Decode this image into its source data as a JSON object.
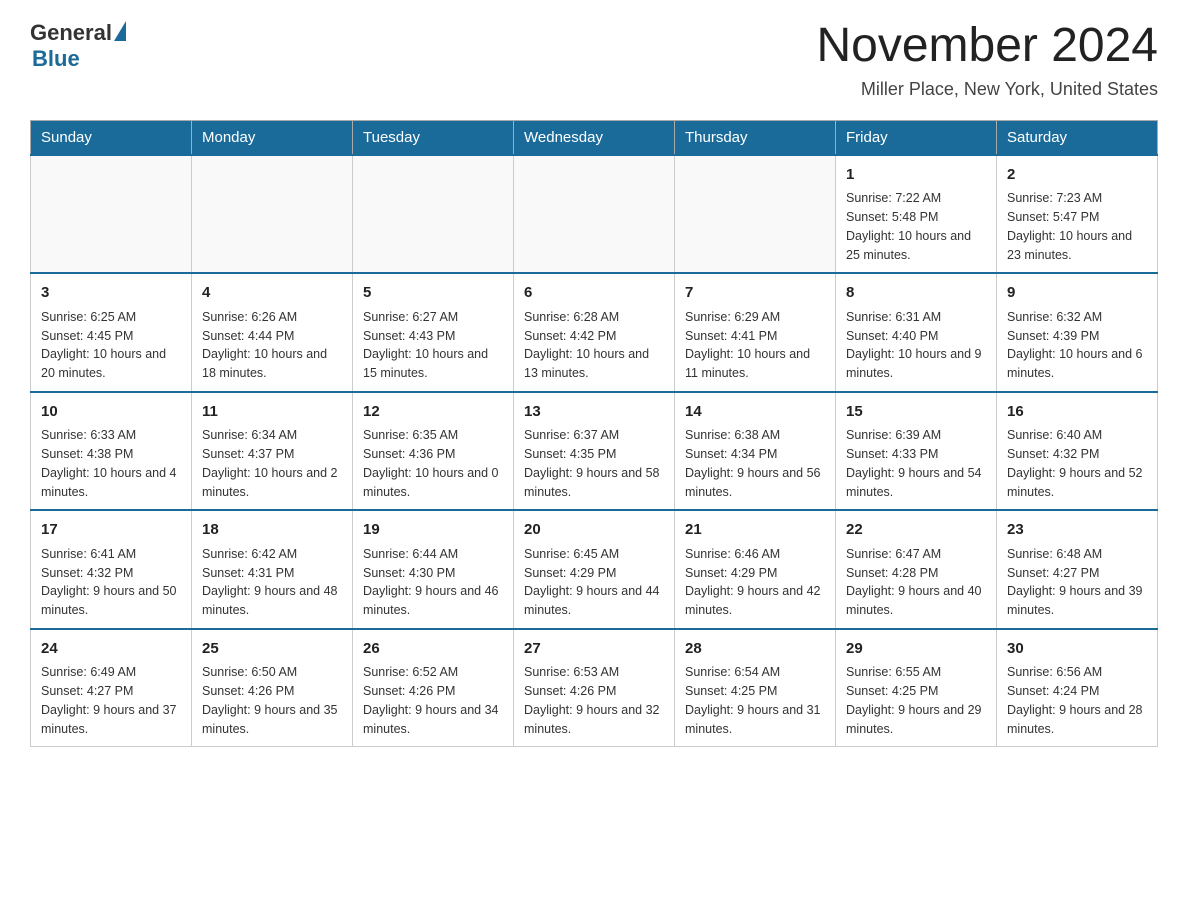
{
  "header": {
    "logo_general": "General",
    "logo_blue": "Blue",
    "month_title": "November 2024",
    "location": "Miller Place, New York, United States"
  },
  "days_of_week": [
    "Sunday",
    "Monday",
    "Tuesday",
    "Wednesday",
    "Thursday",
    "Friday",
    "Saturday"
  ],
  "weeks": [
    [
      {
        "day": "",
        "sunrise": "",
        "sunset": "",
        "daylight": ""
      },
      {
        "day": "",
        "sunrise": "",
        "sunset": "",
        "daylight": ""
      },
      {
        "day": "",
        "sunrise": "",
        "sunset": "",
        "daylight": ""
      },
      {
        "day": "",
        "sunrise": "",
        "sunset": "",
        "daylight": ""
      },
      {
        "day": "",
        "sunrise": "",
        "sunset": "",
        "daylight": ""
      },
      {
        "day": "1",
        "sunrise": "Sunrise: 7:22 AM",
        "sunset": "Sunset: 5:48 PM",
        "daylight": "Daylight: 10 hours and 25 minutes."
      },
      {
        "day": "2",
        "sunrise": "Sunrise: 7:23 AM",
        "sunset": "Sunset: 5:47 PM",
        "daylight": "Daylight: 10 hours and 23 minutes."
      }
    ],
    [
      {
        "day": "3",
        "sunrise": "Sunrise: 6:25 AM",
        "sunset": "Sunset: 4:45 PM",
        "daylight": "Daylight: 10 hours and 20 minutes."
      },
      {
        "day": "4",
        "sunrise": "Sunrise: 6:26 AM",
        "sunset": "Sunset: 4:44 PM",
        "daylight": "Daylight: 10 hours and 18 minutes."
      },
      {
        "day": "5",
        "sunrise": "Sunrise: 6:27 AM",
        "sunset": "Sunset: 4:43 PM",
        "daylight": "Daylight: 10 hours and 15 minutes."
      },
      {
        "day": "6",
        "sunrise": "Sunrise: 6:28 AM",
        "sunset": "Sunset: 4:42 PM",
        "daylight": "Daylight: 10 hours and 13 minutes."
      },
      {
        "day": "7",
        "sunrise": "Sunrise: 6:29 AM",
        "sunset": "Sunset: 4:41 PM",
        "daylight": "Daylight: 10 hours and 11 minutes."
      },
      {
        "day": "8",
        "sunrise": "Sunrise: 6:31 AM",
        "sunset": "Sunset: 4:40 PM",
        "daylight": "Daylight: 10 hours and 9 minutes."
      },
      {
        "day": "9",
        "sunrise": "Sunrise: 6:32 AM",
        "sunset": "Sunset: 4:39 PM",
        "daylight": "Daylight: 10 hours and 6 minutes."
      }
    ],
    [
      {
        "day": "10",
        "sunrise": "Sunrise: 6:33 AM",
        "sunset": "Sunset: 4:38 PM",
        "daylight": "Daylight: 10 hours and 4 minutes."
      },
      {
        "day": "11",
        "sunrise": "Sunrise: 6:34 AM",
        "sunset": "Sunset: 4:37 PM",
        "daylight": "Daylight: 10 hours and 2 minutes."
      },
      {
        "day": "12",
        "sunrise": "Sunrise: 6:35 AM",
        "sunset": "Sunset: 4:36 PM",
        "daylight": "Daylight: 10 hours and 0 minutes."
      },
      {
        "day": "13",
        "sunrise": "Sunrise: 6:37 AM",
        "sunset": "Sunset: 4:35 PM",
        "daylight": "Daylight: 9 hours and 58 minutes."
      },
      {
        "day": "14",
        "sunrise": "Sunrise: 6:38 AM",
        "sunset": "Sunset: 4:34 PM",
        "daylight": "Daylight: 9 hours and 56 minutes."
      },
      {
        "day": "15",
        "sunrise": "Sunrise: 6:39 AM",
        "sunset": "Sunset: 4:33 PM",
        "daylight": "Daylight: 9 hours and 54 minutes."
      },
      {
        "day": "16",
        "sunrise": "Sunrise: 6:40 AM",
        "sunset": "Sunset: 4:32 PM",
        "daylight": "Daylight: 9 hours and 52 minutes."
      }
    ],
    [
      {
        "day": "17",
        "sunrise": "Sunrise: 6:41 AM",
        "sunset": "Sunset: 4:32 PM",
        "daylight": "Daylight: 9 hours and 50 minutes."
      },
      {
        "day": "18",
        "sunrise": "Sunrise: 6:42 AM",
        "sunset": "Sunset: 4:31 PM",
        "daylight": "Daylight: 9 hours and 48 minutes."
      },
      {
        "day": "19",
        "sunrise": "Sunrise: 6:44 AM",
        "sunset": "Sunset: 4:30 PM",
        "daylight": "Daylight: 9 hours and 46 minutes."
      },
      {
        "day": "20",
        "sunrise": "Sunrise: 6:45 AM",
        "sunset": "Sunset: 4:29 PM",
        "daylight": "Daylight: 9 hours and 44 minutes."
      },
      {
        "day": "21",
        "sunrise": "Sunrise: 6:46 AM",
        "sunset": "Sunset: 4:29 PM",
        "daylight": "Daylight: 9 hours and 42 minutes."
      },
      {
        "day": "22",
        "sunrise": "Sunrise: 6:47 AM",
        "sunset": "Sunset: 4:28 PM",
        "daylight": "Daylight: 9 hours and 40 minutes."
      },
      {
        "day": "23",
        "sunrise": "Sunrise: 6:48 AM",
        "sunset": "Sunset: 4:27 PM",
        "daylight": "Daylight: 9 hours and 39 minutes."
      }
    ],
    [
      {
        "day": "24",
        "sunrise": "Sunrise: 6:49 AM",
        "sunset": "Sunset: 4:27 PM",
        "daylight": "Daylight: 9 hours and 37 minutes."
      },
      {
        "day": "25",
        "sunrise": "Sunrise: 6:50 AM",
        "sunset": "Sunset: 4:26 PM",
        "daylight": "Daylight: 9 hours and 35 minutes."
      },
      {
        "day": "26",
        "sunrise": "Sunrise: 6:52 AM",
        "sunset": "Sunset: 4:26 PM",
        "daylight": "Daylight: 9 hours and 34 minutes."
      },
      {
        "day": "27",
        "sunrise": "Sunrise: 6:53 AM",
        "sunset": "Sunset: 4:26 PM",
        "daylight": "Daylight: 9 hours and 32 minutes."
      },
      {
        "day": "28",
        "sunrise": "Sunrise: 6:54 AM",
        "sunset": "Sunset: 4:25 PM",
        "daylight": "Daylight: 9 hours and 31 minutes."
      },
      {
        "day": "29",
        "sunrise": "Sunrise: 6:55 AM",
        "sunset": "Sunset: 4:25 PM",
        "daylight": "Daylight: 9 hours and 29 minutes."
      },
      {
        "day": "30",
        "sunrise": "Sunrise: 6:56 AM",
        "sunset": "Sunset: 4:24 PM",
        "daylight": "Daylight: 9 hours and 28 minutes."
      }
    ]
  ]
}
